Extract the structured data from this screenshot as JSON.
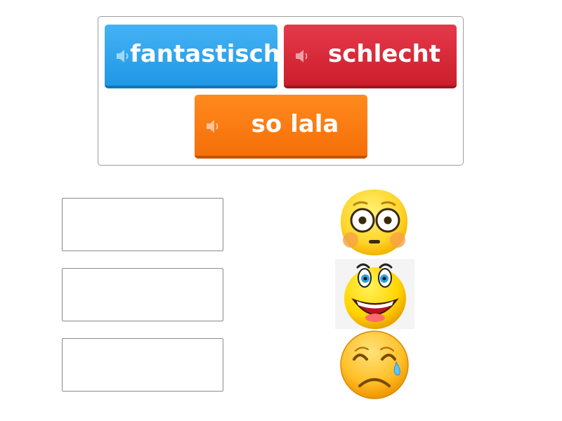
{
  "word_bank": {
    "tiles": [
      {
        "label": "fantastisch",
        "color": "#2ea5ee",
        "icon": "speaker-icon"
      },
      {
        "label": "schlecht",
        "color": "#d8232f",
        "icon": "speaker-icon"
      },
      {
        "label": "so lala",
        "color": "#f97d10",
        "icon": "speaker-icon"
      }
    ]
  },
  "targets": [
    {
      "image": "flushed-face-emoji"
    },
    {
      "image": "laughing-face-emoji"
    },
    {
      "image": "crying-face-emoji"
    }
  ]
}
